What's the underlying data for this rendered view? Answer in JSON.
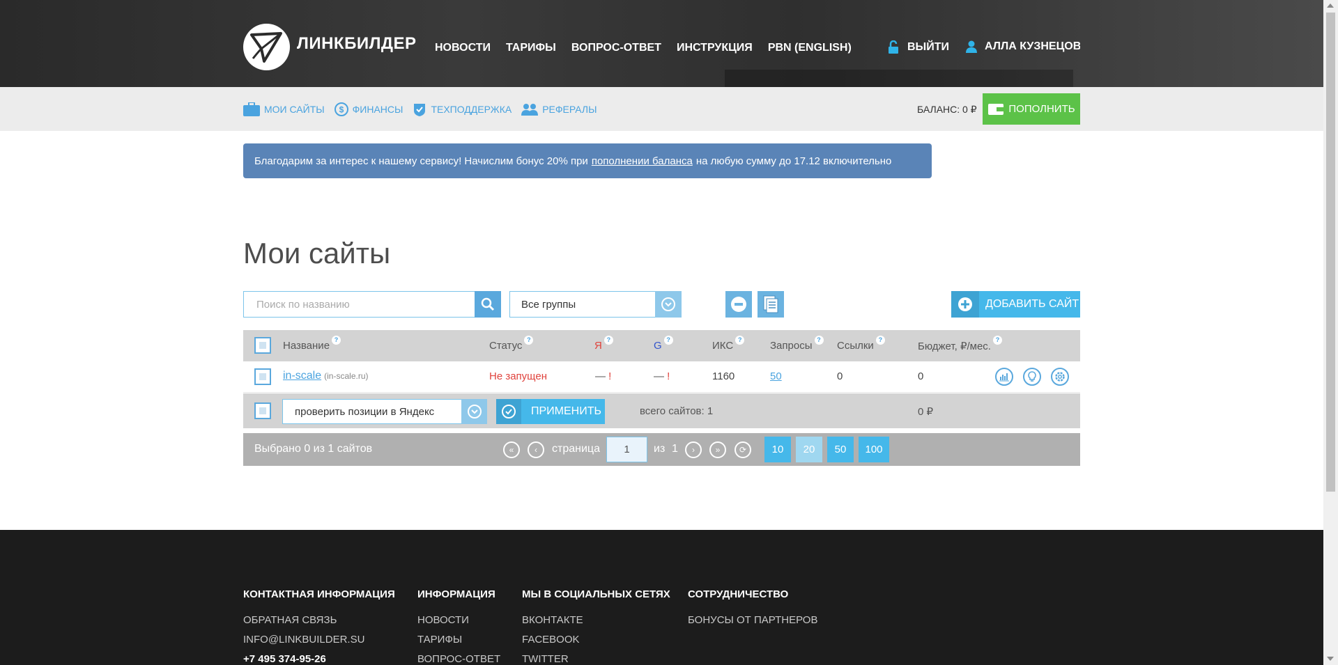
{
  "header": {
    "logo_text": "ЛИНКБИЛДЕР",
    "nav": [
      "НОВОСТИ",
      "ТАРИФЫ",
      "ВОПРОС-ОТВЕТ",
      "ИНСТРУКЦИЯ",
      "PBN (ENGLISH)"
    ],
    "logout_label": "ВЫЙТИ",
    "user_name": "АЛЛА КУЗНЕЦОВА"
  },
  "subnav": {
    "items": [
      "МОИ САЙТЫ",
      "ФИНАНСЫ",
      "ТЕХПОДДЕРЖКА",
      "РЕФЕРАЛЫ"
    ],
    "balance": "БАЛАНС: 0 ₽",
    "topup_label": "ПОПОЛНИТЬ"
  },
  "notice": {
    "before": "Благодарим за интерес к нашему сервису! Начислим бонус 20% при",
    "link": "пополнении баланса",
    "after": "на любую сумму до 17.12 включительно"
  },
  "page_title": "Мои сайты",
  "toolbar": {
    "search_placeholder": "Поиск по названию",
    "group_value": "Все группы",
    "add_site_label": "ДОБАВИТЬ САЙТ"
  },
  "table": {
    "columns": [
      "Название",
      "Статус",
      "Я",
      "G",
      "ИКС",
      "Запросы",
      "Ссылки",
      "Бюджет, ₽/мес."
    ],
    "help_mark": "?",
    "rows": [
      {
        "name": "in-scale",
        "domain": "(in-scale.ru)",
        "status": "Не запущен",
        "yandex": "—",
        "google": "—",
        "alert": "!",
        "iks": "1160",
        "queries": "50",
        "links": "0",
        "budget": "0"
      }
    ]
  },
  "actions": {
    "selected_action": "проверить позиции в Яндекс",
    "apply_label": "ПРИМЕНИТЬ",
    "total_sites": "всего сайтов: 1",
    "total_sum": "0 ₽"
  },
  "pager": {
    "selected_info": "Выбрано 0 из 1 сайтов",
    "page_label": "страница",
    "current_page": "1",
    "of_label": "из",
    "total_pages": "1",
    "per_page": [
      "10",
      "20",
      "50",
      "100"
    ]
  },
  "footer": {
    "columns": [
      {
        "title": "КОНТАКТНАЯ ИНФОРМАЦИЯ",
        "links": [
          "ОБРАТНАЯ СВЯЗЬ",
          "INFO@LINKBUILDER.SU",
          "+7 495 374-95-26"
        ]
      },
      {
        "title": "ИНФОРМАЦИЯ",
        "links": [
          "НОВОСТИ",
          "ТАРИФЫ",
          "ВОПРОС-ОТВЕТ"
        ]
      },
      {
        "title": "МЫ В СОЦИАЛЬНЫХ СЕТЯХ",
        "links": [
          "ВКОНТАКТЕ",
          "FACEBOOK",
          "TWITTER"
        ]
      },
      {
        "title": "СОТРУДНИЧЕСТВО",
        "links": [
          "БОНУСЫ ОТ ПАРТНЕРОВ"
        ]
      }
    ]
  },
  "colors": {
    "accent": "#45b8ea",
    "green": "#5cc248",
    "notice": "#5a84b7",
    "status_red": "#e0433d"
  }
}
